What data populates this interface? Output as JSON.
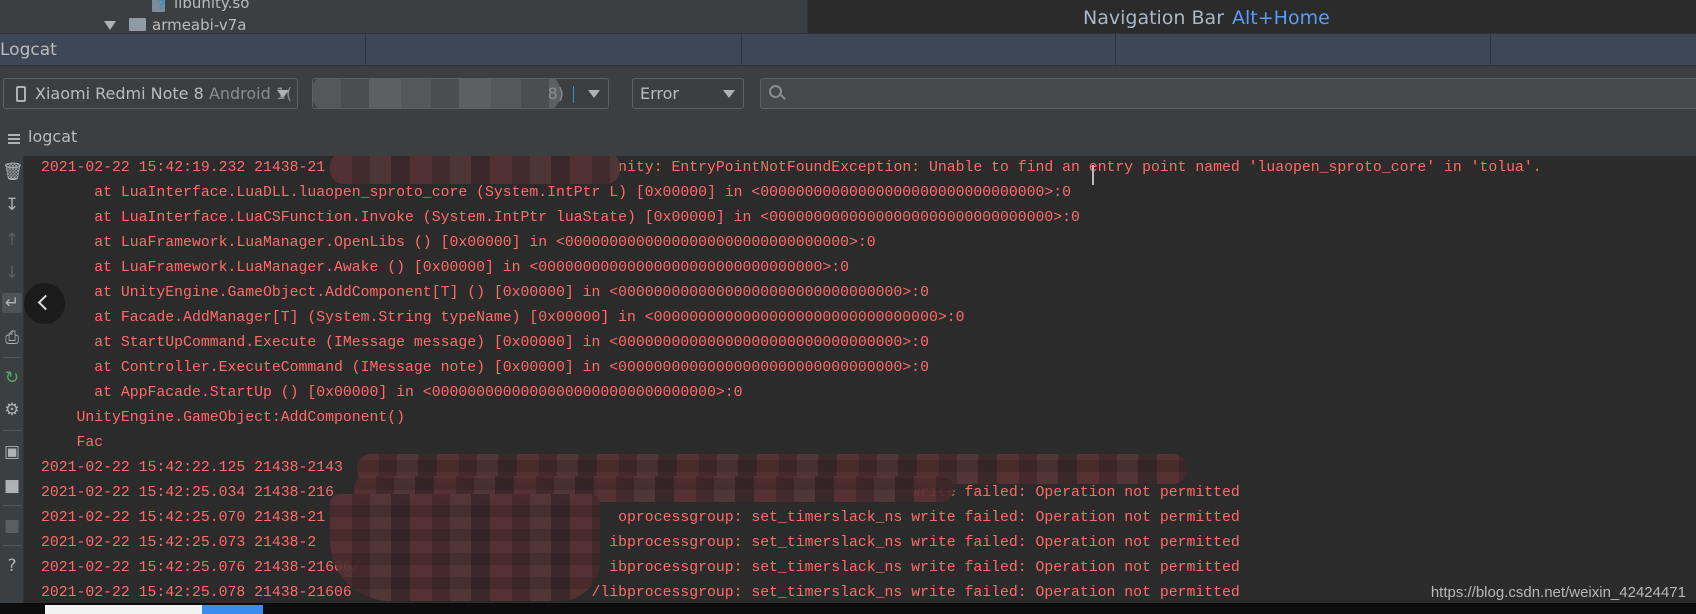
{
  "project_tree": {
    "items": [
      {
        "label": "libunity.so",
        "icon": "unknown-file-icon"
      },
      {
        "label": "armeabi-v7a",
        "icon": "folder-icon",
        "expanded": true
      }
    ]
  },
  "navigation_hint": {
    "label": "Navigation Bar",
    "shortcut": "Alt+Home"
  },
  "panel": {
    "title": "Logcat"
  },
  "toolbar": {
    "device": {
      "name": "Xiaomi Redmi Note 8",
      "os": "Android 1("
    },
    "process": {
      "visible_suffix": "8)"
    },
    "level": {
      "selected": "Error"
    },
    "search": {
      "placeholder": "",
      "value": ""
    }
  },
  "tab": {
    "label": "logcat"
  },
  "side_tools": [
    "trash-icon",
    "scroll-to-end-icon",
    "arrow-up-icon",
    "arrow-down-icon",
    "soft-wrap-icon",
    "print-icon",
    "restart-icon",
    "gear-icon",
    "camera-icon",
    "video-icon",
    "stop-icon",
    "help-icon"
  ],
  "colors": {
    "error": "#ff6b68",
    "accent": "#589df6"
  },
  "log": {
    "rows": [
      {
        "text": "2021-02-22 15:42:19.232 21438-21",
        "tail": "nity: EntryPointNotFoundException: Unable to find an entry point named 'luaopen_sproto_core' in 'tolua'."
      },
      {
        "text": "at LuaInterface.LuaDLL.luaopen_sproto_core (System.IntPtr L) [0x00000] in <00000000000000000000000000000000>:0"
      },
      {
        "text": "at LuaInterface.LuaCSFunction.Invoke (System.IntPtr luaState) [0x00000] in <00000000000000000000000000000000>:0"
      },
      {
        "text": "at LuaFramework.LuaManager.OpenLibs () [0x00000] in <00000000000000000000000000000000>:0"
      },
      {
        "text": "at LuaFramework.LuaManager.Awake () [0x00000] in <00000000000000000000000000000000>:0"
      },
      {
        "text": "at UnityEngine.GameObject.AddComponent[T] () [0x00000] in <00000000000000000000000000000000>:0"
      },
      {
        "text": "at Facade.AddManager[T] (System.String typeName) [0x00000] in <00000000000000000000000000000000>:0"
      },
      {
        "text": "at StartUpCommand.Execute (IMessage message) [0x00000] in <00000000000000000000000000000000>:0"
      },
      {
        "text": "at Controller.ExecuteCommand (IMessage note) [0x00000] in <00000000000000000000000000000000>:0"
      },
      {
        "text": "at AppFacade.StartUp () [0x00000] in <00000000000000000000000000000000>:0"
      },
      {
        "text": "UnityEngine.GameObject:AddComponent()"
      },
      {
        "text": "Fac"
      },
      {
        "text": "2021-02-22 15:42:22.125 21438-2143"
      },
      {
        "text": "2021-02-22 15:42:25.034 21438-216",
        "tail": "write failed: Operation not permitted"
      },
      {
        "text": "2021-02-22 15:42:25.070 21438-21",
        "tail": "oprocessgroup: set_timerslack_ns write failed: Operation not permitted"
      },
      {
        "text": "2021-02-22 15:42:25.073 21438-2",
        "tail": "ibprocessgroup: set_timerslack_ns write failed: Operation not permitted"
      },
      {
        "text": "2021-02-22 15:42:25.076 21438-21606/",
        "tail": "ibprocessgroup: set_timerslack_ns write failed: Operation not permitted"
      },
      {
        "text": "2021-02-22 15:42:25.078 21438-21606",
        "tail": "/libprocessgroup: set_timerslack_ns write failed: Operation not permitted"
      }
    ]
  },
  "watermark": "https://blog.csdn.net/weixin_42424471"
}
